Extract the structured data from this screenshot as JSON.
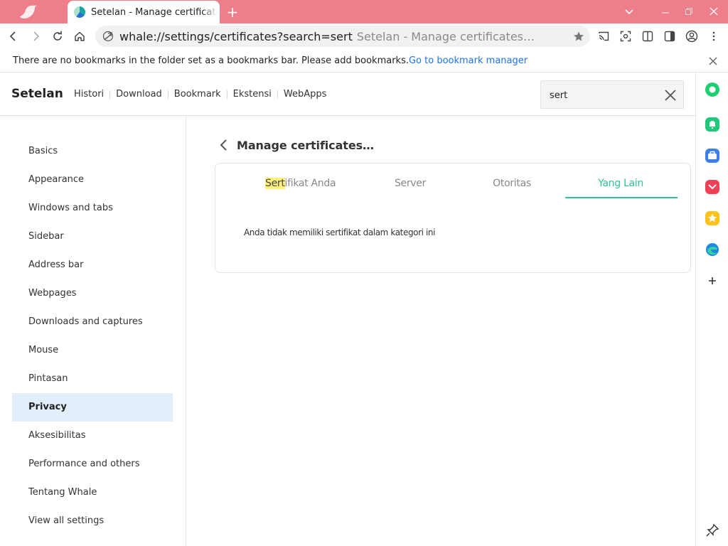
{
  "browser": {
    "tab_title": "Setelan - Manage certificates…",
    "new_tab_label": "+",
    "url": "whale://settings/certificates?search=sert",
    "url_page_title": "Setelan - Manage certificates…"
  },
  "bookmarks_bar": {
    "message": "There are no bookmarks in the folder set as a bookmarks bar. Please add bookmarks.",
    "link": "Go to bookmark manager"
  },
  "header": {
    "brand": "Setelan",
    "nav": [
      "Histori",
      "Download",
      "Bookmark",
      "Ekstensi",
      "WebApps"
    ],
    "search_value": "sert"
  },
  "sidebar": {
    "items": [
      "Basics",
      "Appearance",
      "Windows and tabs",
      "Sidebar",
      "Address bar",
      "Webpages",
      "Downloads and captures",
      "Mouse",
      "Pintasan",
      "Privacy",
      "Aksesibilitas",
      "Performance and others",
      "Tentang Whale",
      "View all settings"
    ],
    "active_item": "Privacy"
  },
  "page": {
    "title": "Manage certificates…",
    "tabs": {
      "your_certs_highlight": "Sert",
      "your_certs_rest": "ifikat Anda",
      "server": "Server",
      "authorities": "Otoritas",
      "others": "Yang Lain"
    },
    "active_tab": "Yang Lain",
    "empty_message": "Anda tidak memiliki sertifikat dalam kategori ini"
  },
  "colors": {
    "titlebar": "#ee7f8a",
    "accent": "#2fbf99",
    "active_nav_bg": "#e3eefb",
    "search_highlight": "#fff27c",
    "link": "#1a73e8"
  },
  "icons": {
    "titlebar": [
      "bird-logo-icon",
      "whale-favicon-icon",
      "chevron-down-icon",
      "minimize-icon",
      "restore-icon",
      "close-window-icon"
    ],
    "toolbar": [
      "back-icon",
      "forward-icon",
      "reload-icon",
      "home-icon",
      "site-info-icon",
      "bookmark-star-icon",
      "cast-icon",
      "screenshot-icon",
      "split-view-icon",
      "sidebar-toggle-icon",
      "profile-icon",
      "menu-icon"
    ],
    "rightbar": [
      "green-status-icon",
      "notification-icon",
      "wallet-icon",
      "pocket-icon",
      "favorites-star-icon",
      "edge-icon",
      "add-icon",
      "pin-icon"
    ]
  }
}
